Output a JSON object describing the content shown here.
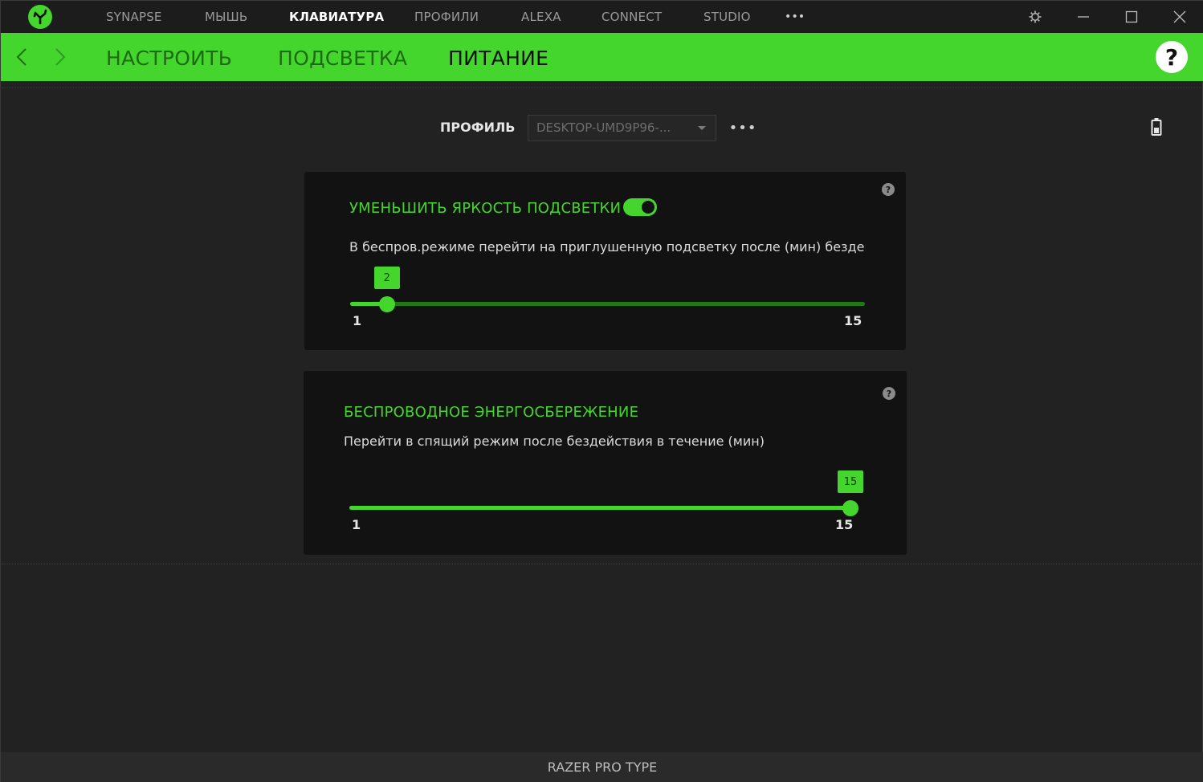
{
  "top_nav": {
    "items": [
      "SYNAPSE",
      "МЫШЬ",
      "КЛАВИАТУРА",
      "ПРОФИЛИ",
      "ALEXA",
      "CONNECT",
      "STUDIO"
    ],
    "active": "КЛАВИАТУРА",
    "more_label": "•••"
  },
  "window_controls": [
    "gear-icon",
    "minimize-icon",
    "maximize-icon",
    "close-icon"
  ],
  "sub_nav": {
    "tabs": [
      "НАСТРОИТЬ",
      "ПОДСВЕТКА",
      "ПИТАНИЕ"
    ],
    "active": "ПИТАНИЕ",
    "help_label": "?"
  },
  "profile": {
    "label": "ПРОФИЛЬ",
    "selected": "DESKTOP-UMD9P96-...",
    "more_label": "•••"
  },
  "cards": [
    {
      "title": "УМЕНЬШИТЬ ЯРКОСТЬ ПОДСВЕТКИ",
      "toggle_on": true,
      "description": "В беспров.режиме перейти на приглушенную подсветку после (мин) бездейст",
      "slider": {
        "min": 1,
        "max": 15,
        "value": 2,
        "min_label": "1",
        "max_label": "15",
        "value_label": "2"
      }
    },
    {
      "title": "БЕСПРОВОДНОЕ ЭНЕРГОСБЕРЕЖЕНИЕ",
      "description": "Перейти в спящий режим после бездействия в течение (мин)",
      "slider": {
        "min": 1,
        "max": 15,
        "value": 15,
        "min_label": "1",
        "max_label": "15",
        "value_label": "15"
      }
    }
  ],
  "footer": {
    "device_name": "RAZER PRO TYPE"
  },
  "colors": {
    "accent": "#44d62c",
    "background": "#222222",
    "card": "#121212"
  }
}
